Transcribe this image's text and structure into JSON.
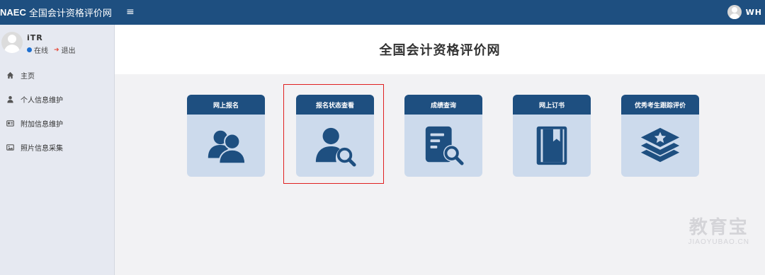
{
  "header": {
    "brand_abbr": "NAEC",
    "brand_name": "全国会计资格评价网",
    "menu_toggle": "≡",
    "user_name": "WH"
  },
  "sidebar": {
    "user_name": "iTR",
    "status_online": "在线",
    "logout": "退出",
    "items": [
      {
        "label": "主页",
        "icon": "home-icon"
      },
      {
        "label": "个人信息维护",
        "icon": "user-icon"
      },
      {
        "label": "附加信息维护",
        "icon": "id-card-icon"
      },
      {
        "label": "照片信息采集",
        "icon": "image-icon"
      }
    ]
  },
  "main": {
    "title": "全国会计资格评价网",
    "cards": [
      {
        "label": "网上报名",
        "icon": "users-icon"
      },
      {
        "label": "报名状态查看",
        "icon": "user-search-icon",
        "highlighted": true
      },
      {
        "label": "成绩查询",
        "icon": "document-search-icon"
      },
      {
        "label": "网上订书",
        "icon": "book-icon"
      },
      {
        "label": "优秀考生跟踪评价",
        "icon": "layers-star-icon"
      }
    ]
  },
  "watermark": {
    "cn": "教育宝",
    "en": "JIAOYUBAO.CN"
  },
  "colors": {
    "primary": "#1e4f80",
    "card_bg": "#ccdaec",
    "sidebar_bg": "#e6e9f1",
    "highlight": "#e02020"
  }
}
